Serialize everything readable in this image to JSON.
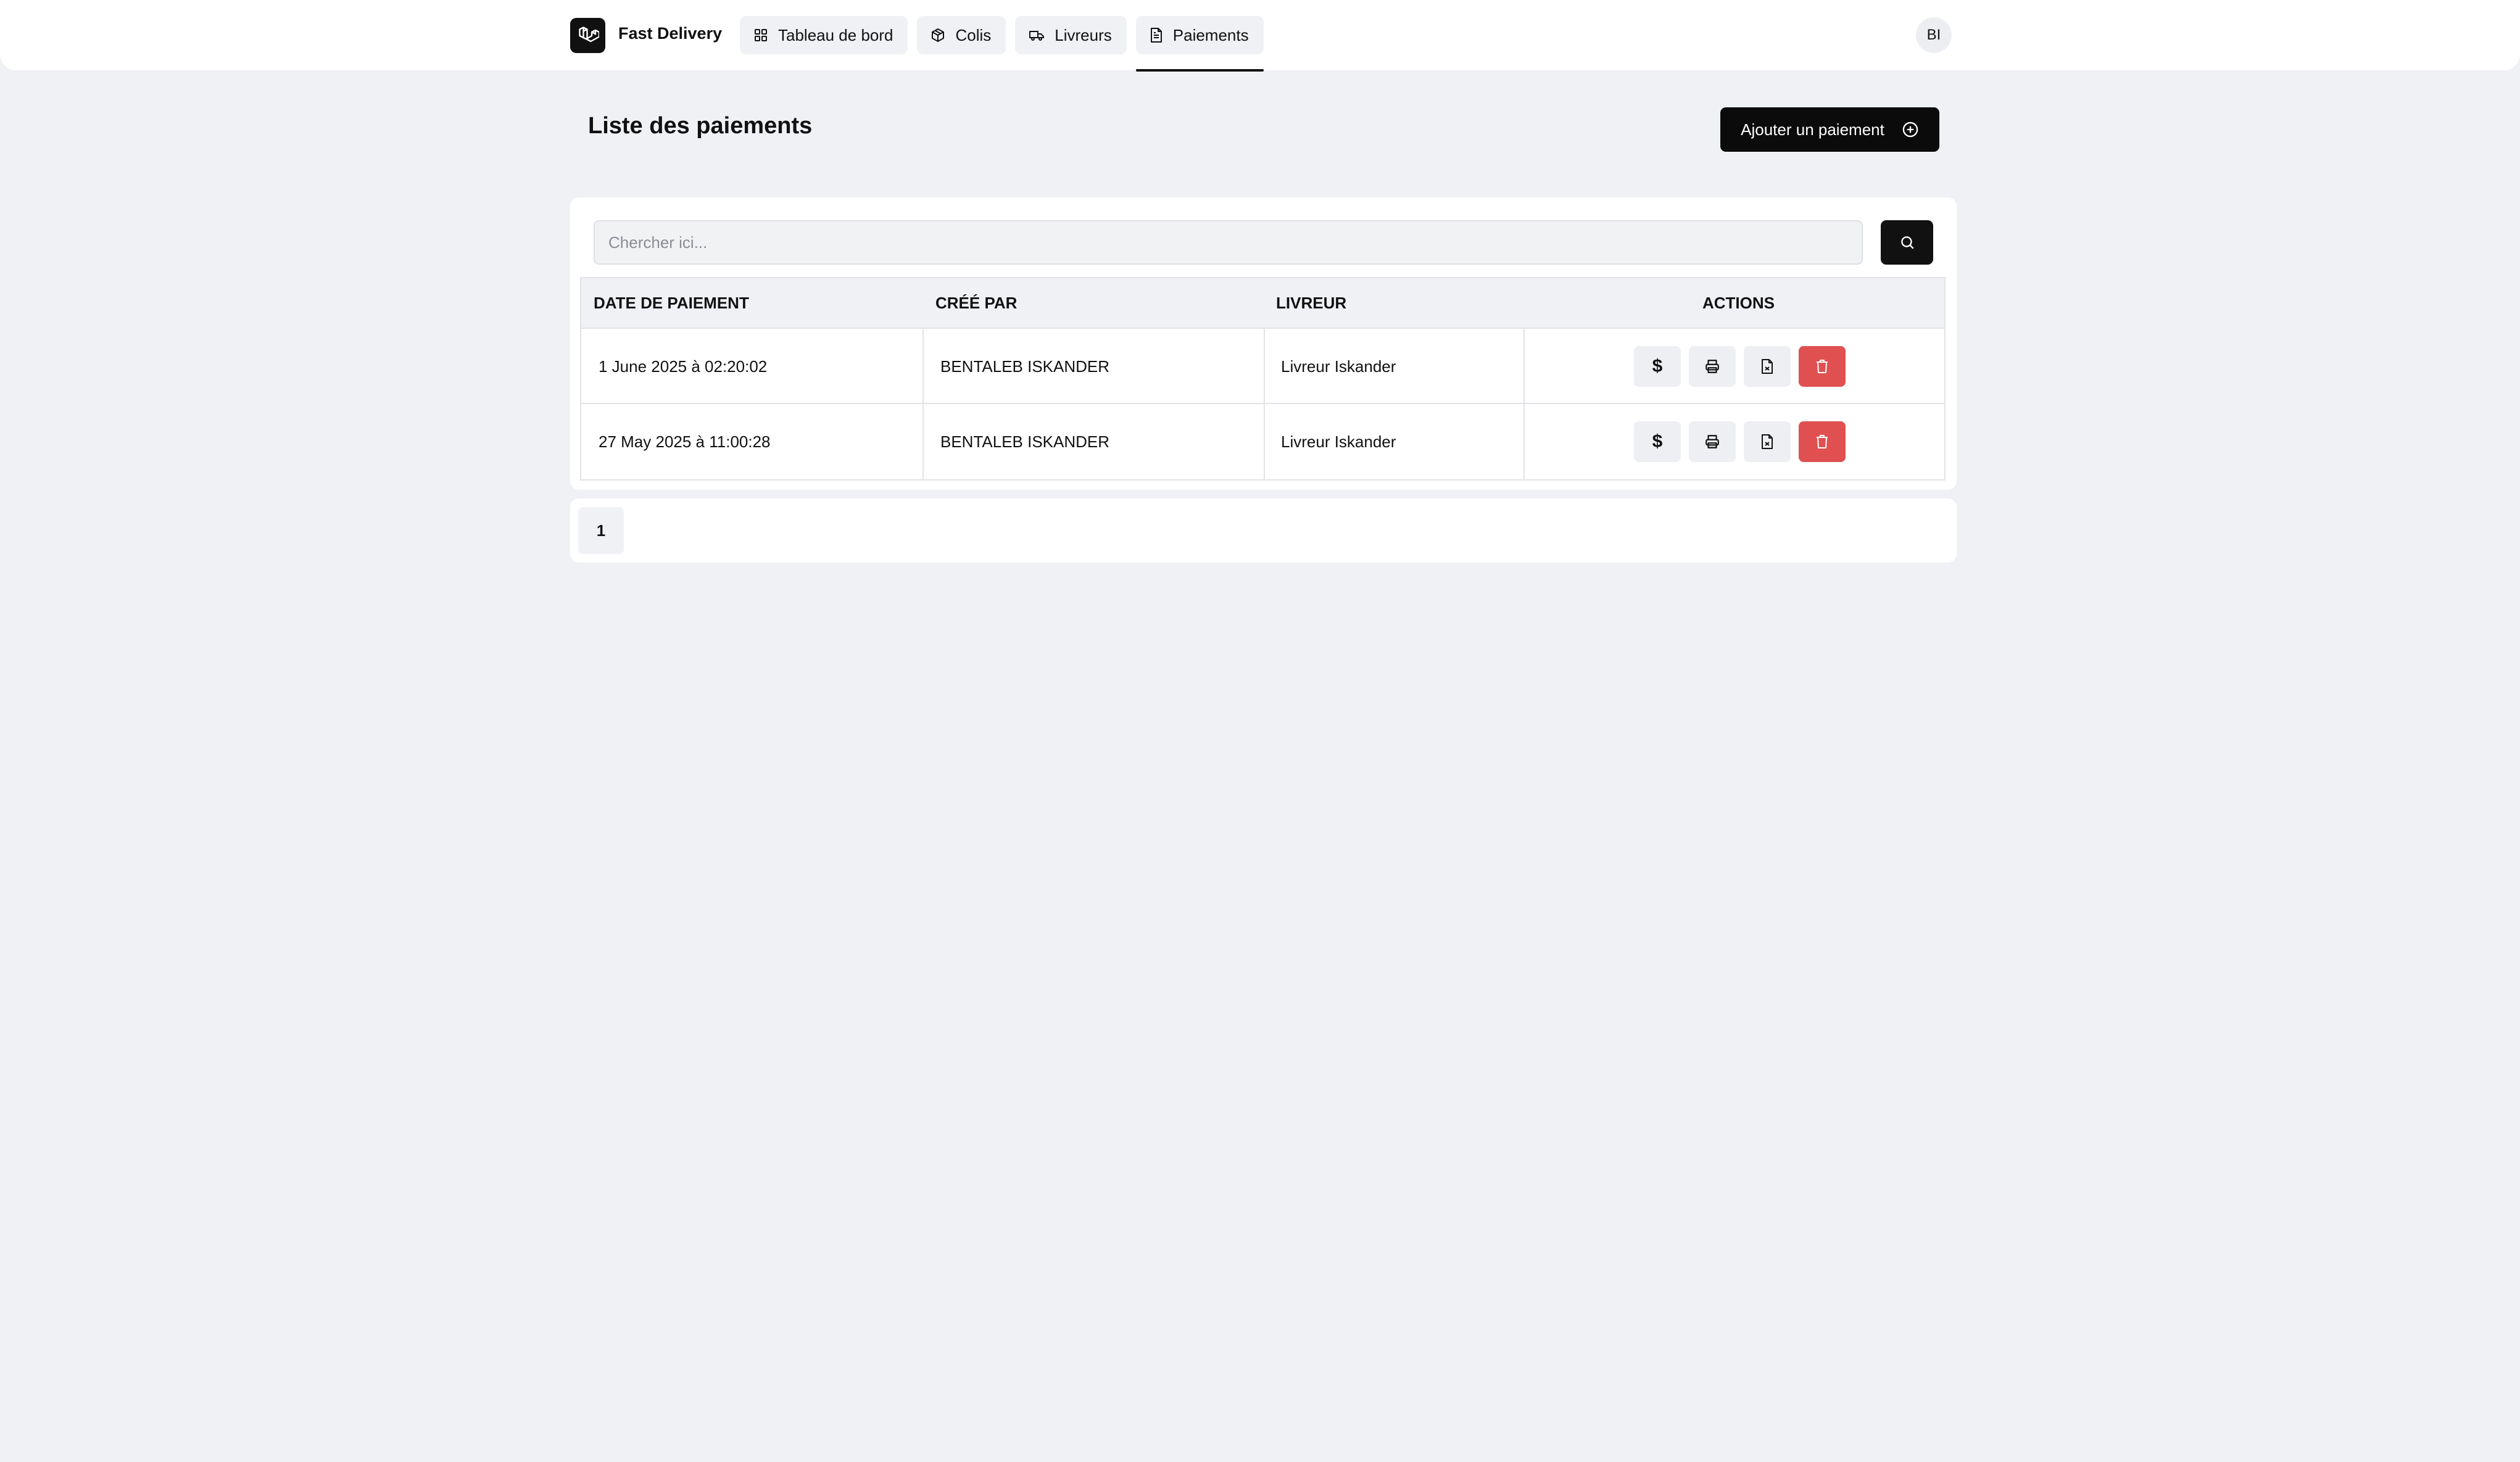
{
  "app": {
    "name": "Fast Delivery",
    "logo_icon": "laravel-icon"
  },
  "nav": {
    "tabs": [
      {
        "label": "Tableau de bord",
        "icon": "dashboard-grid-icon"
      },
      {
        "label": "Colis",
        "icon": "package-icon"
      },
      {
        "label": "Livreurs",
        "icon": "truck-icon"
      },
      {
        "label": "Paiements",
        "icon": "document-icon",
        "active": true
      }
    ]
  },
  "user": {
    "initials": "BI"
  },
  "page": {
    "title": "Liste des paiements",
    "add_button_label": "Ajouter un paiement"
  },
  "search": {
    "placeholder": "Chercher ici...",
    "value": ""
  },
  "table": {
    "columns": [
      "DATE DE PAIEMENT",
      "CRÉÉ PAR",
      "LIVREUR",
      "ACTIONS"
    ],
    "rows": [
      {
        "date": "1 June 2025 à 02:20:02",
        "created_by": "BENTALEB ISKANDER",
        "livreur": "Livreur Iskander"
      },
      {
        "date": "27 May 2025 à 11:00:28",
        "created_by": "BENTALEB ISKANDER",
        "livreur": "Livreur Iskander"
      }
    ],
    "action_icons": [
      "dollar-icon",
      "printer-icon",
      "file-pdf-icon",
      "trash-icon"
    ]
  },
  "pagination": {
    "current_page": "1"
  },
  "colors": {
    "background": "#f0f1f5",
    "primary": "#0b0b0b",
    "danger": "#e05050",
    "surface": "#ffffff"
  }
}
